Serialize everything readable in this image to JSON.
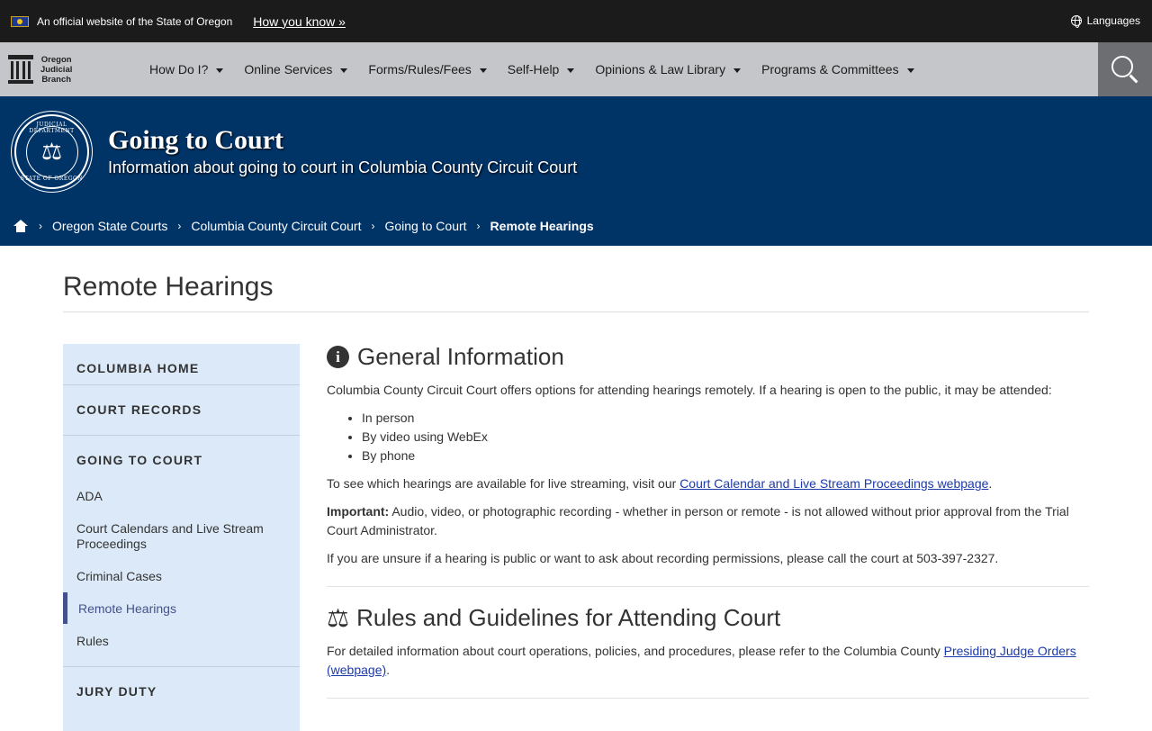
{
  "gov_bar": {
    "official_text": "An official website of the State of Oregon",
    "how_you_know": "How you know »",
    "languages": "Languages"
  },
  "nav": {
    "logo_lines": [
      "Oregon",
      "Judicial",
      "Branch"
    ],
    "items": [
      {
        "label": "How Do I?"
      },
      {
        "label": "Online Services"
      },
      {
        "label": "Forms/Rules/Fees"
      },
      {
        "label": "Self-Help"
      },
      {
        "label": "Opinions & Law Library"
      },
      {
        "label": "Programs & Committees"
      }
    ]
  },
  "banner": {
    "seal_top": "JUDICIAL DEPARTMENT",
    "seal_bottom": "STATE OF OREGON",
    "title": "Going to Court",
    "subtitle": "Information about going to court in Columbia County Circuit Court"
  },
  "breadcrumb": {
    "items": [
      "Oregon State Courts",
      "Columbia County Circuit Court",
      "Going to Court"
    ],
    "current": "Remote Hearings"
  },
  "page_title": "Remote Hearings",
  "sidebar": {
    "sections": {
      "columbia_home": "COLUMBIA HOME",
      "court_records": "COURT RECORDS",
      "going_to_court": "GOING TO COURT",
      "jury_duty": "JURY DUTY"
    },
    "links": {
      "ada": "ADA",
      "calendars": "Court Calendars and Live Stream Proceedings",
      "criminal": "Criminal Cases",
      "remote": "Remote Hearings",
      "rules": "Rules"
    }
  },
  "general_info": {
    "heading": "General Information",
    "intro": "Columbia County Circuit Court offers options for attending hearings remotely.  If a hearing is open to the public, it may be attended:",
    "options": [
      "In person",
      "By video using WebEx",
      "By phone"
    ],
    "stream_prefix": "To see which hearings are available for live streaming, visit our ",
    "stream_link": "Court Calendar and Live Stream Proceedings webpage",
    "stream_suffix": ".",
    "important_label": "Important:",
    "important_text": "  Audio, video, or photographic recording - whether in person or remote - is not allowed without prior approval from the Trial Court Administrator.",
    "unsure": "If you are unsure if a hearing is public or want to ask about recording permissions, please call the court at 503-397-2327."
  },
  "rules_section": {
    "heading": "Rules and Guidelines for Attending Court",
    "text_prefix": "For detailed information about court operations, policies, and procedures, please refer to the Columbia County ",
    "link": "Presiding Judge Orders (webpage)",
    "text_suffix": "."
  },
  "icons": {
    "info": "info-circle-icon",
    "scale": "balance-scale-icon",
    "search": "search-icon",
    "home": "home-icon",
    "globe": "globe-icon"
  },
  "colors": {
    "top_bar": "#1b1b1b",
    "nav_bar": "#c4c6c9",
    "banner": "#003366",
    "sidebar_bg": "#dbe9f8",
    "active_marker": "#44528c",
    "link": "#1c3aa9"
  }
}
